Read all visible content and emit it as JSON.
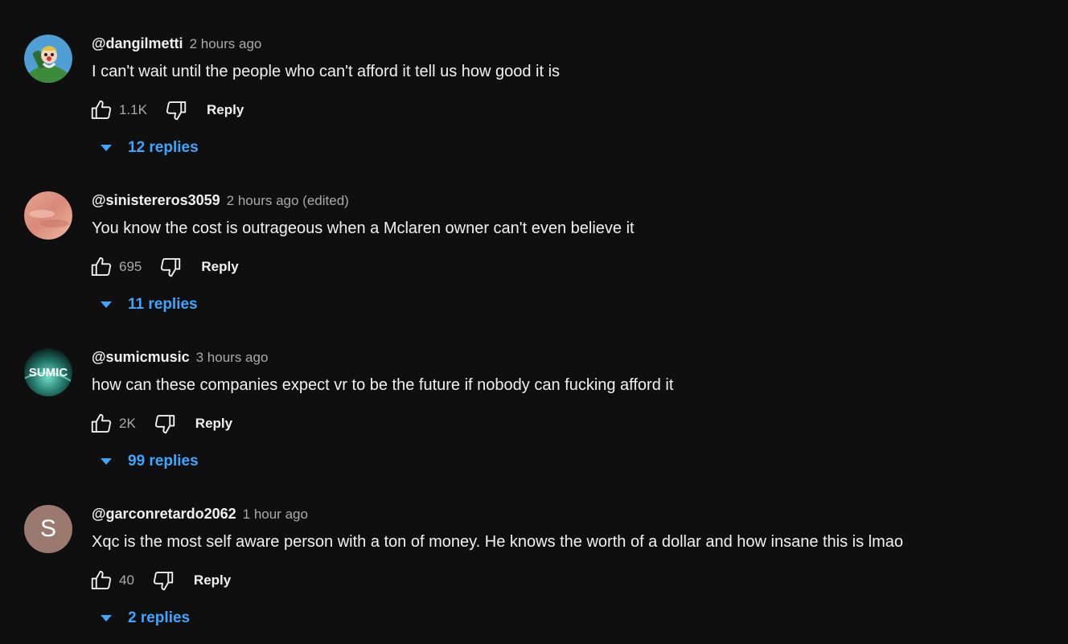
{
  "comments": [
    {
      "author": "@dangilmetti",
      "time": "2 hours ago",
      "text": "I can't wait until the people who can't afford it tell us how good it is",
      "likes": "1.1K",
      "reply_label": "Reply",
      "replies_label": "12 replies",
      "avatar": "cartoon-character-avatar"
    },
    {
      "author": "@sinistereros3059",
      "time": "2 hours ago (edited)",
      "text": "You know the cost is outrageous when a Mclaren owner can't even believe it",
      "likes": "695",
      "reply_label": "Reply",
      "replies_label": "11 replies",
      "avatar": "pink-sky-avatar"
    },
    {
      "author": "@sumicmusic",
      "time": "3 hours ago",
      "text": "how can these companies expect vr to be the future if nobody can fucking afford it",
      "likes": "2K",
      "reply_label": "Reply",
      "replies_label": "99 replies",
      "avatar": "sumic-logo-avatar",
      "avatar_text": "SUMIC"
    },
    {
      "author": "@garconretardo2062",
      "time": "1 hour ago",
      "text": "Xqc is the most self aware person with a ton of money. He knows the worth of a dollar and how insane this is lmao",
      "likes": "40",
      "reply_label": "Reply",
      "replies_label": "2 replies",
      "avatar": "letter-avatar",
      "avatar_letter": "S"
    }
  ],
  "colors": {
    "background": "#0f0f0f",
    "text": "#f1f1f1",
    "secondary_text": "#aaaaaa",
    "link_blue": "#3ea6ff"
  }
}
